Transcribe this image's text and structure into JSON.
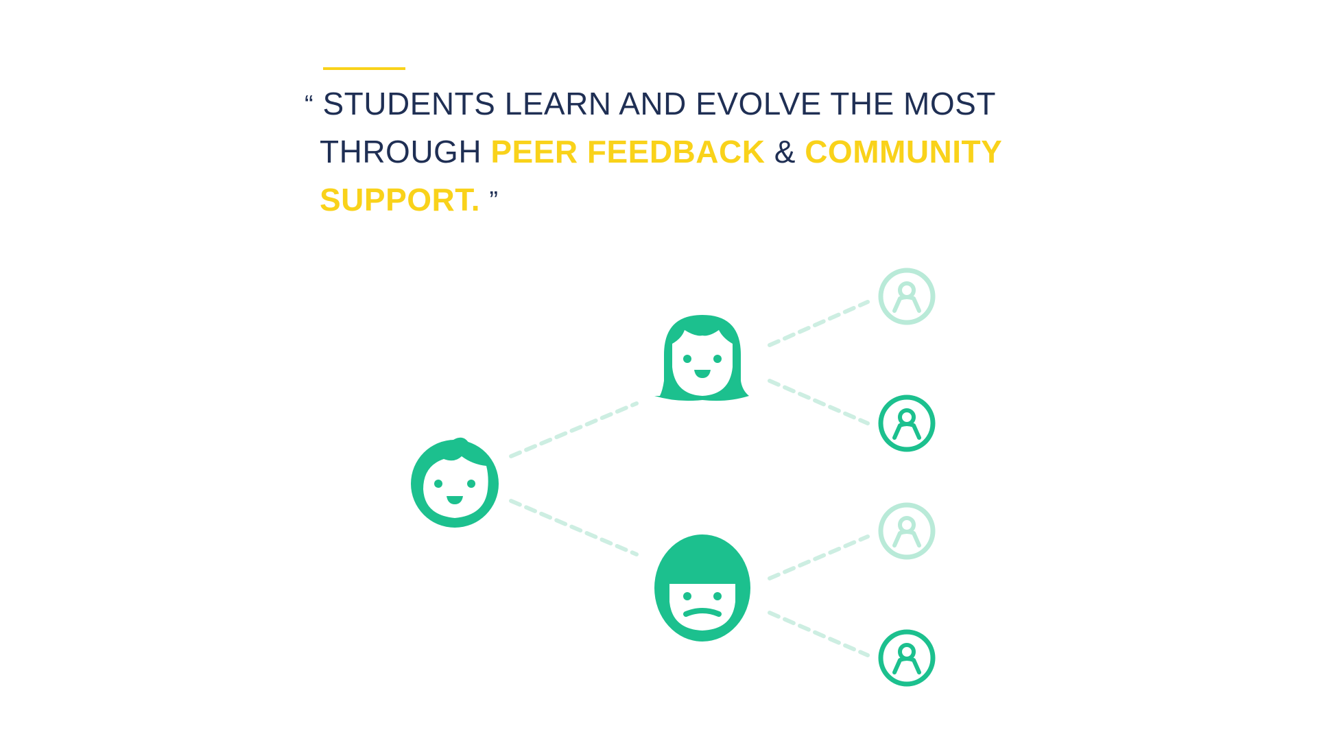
{
  "quote": {
    "open_mark": "“",
    "line1": "STUDENTS LEARN AND EVOLVE THE MOST",
    "line2_prefix": "THROUGH ",
    "highlight1": "PEER FEEDBACK",
    "amp": " & ",
    "highlight2": "COMMUNITY",
    "highlight3": "SUPPORT.",
    "close_mark": "”"
  },
  "colors": {
    "navy": "#1f2f54",
    "yellow": "#f9d21a",
    "green": "#1cc08e",
    "green_faded": "#b9ead8",
    "connector": "#cdeee2"
  },
  "diagram": {
    "nodes": [
      {
        "id": "student-boy",
        "icon": "boy-face-icon"
      },
      {
        "id": "peer-girl",
        "icon": "girl-face-icon"
      },
      {
        "id": "peer-bowlcut",
        "icon": "bowlcut-face-icon"
      },
      {
        "id": "community-1",
        "icon": "user-circle-icon",
        "faded": true
      },
      {
        "id": "community-2",
        "icon": "user-circle-icon",
        "faded": false
      },
      {
        "id": "community-3",
        "icon": "user-circle-icon",
        "faded": true
      },
      {
        "id": "community-4",
        "icon": "user-circle-icon",
        "faded": false
      }
    ]
  }
}
